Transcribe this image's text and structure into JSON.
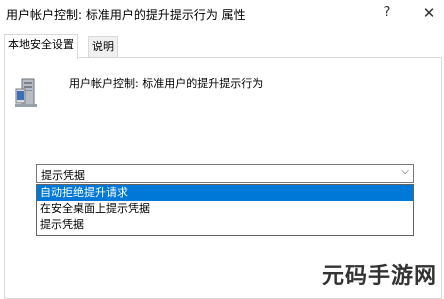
{
  "window": {
    "title": "用户帐户控制: 标准用户的提升提示行为 属性",
    "help_glyph": "?",
    "close_glyph": "✕"
  },
  "tabs": [
    {
      "label": "本地安全设置",
      "active": true
    },
    {
      "label": "说明",
      "active": false
    }
  ],
  "policy": {
    "icon": "computer-icon",
    "name": "用户帐户控制: 标准用户的提升提示行为"
  },
  "select": {
    "value": "提示凭据",
    "chevron": "⌵",
    "options": [
      {
        "label": "自动拒绝提升请求",
        "highlighted": true
      },
      {
        "label": "在安全桌面上提示凭据",
        "highlighted": false
      },
      {
        "label": "提示凭据",
        "highlighted": false
      }
    ]
  },
  "watermark": "元码手游网",
  "colors": {
    "highlight": "#0078d7",
    "border": "#d9d9d9"
  }
}
